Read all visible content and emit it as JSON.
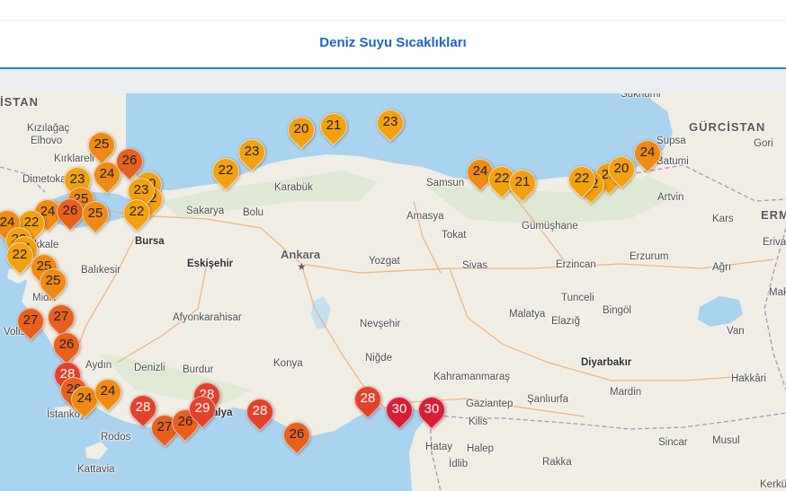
{
  "page": {
    "title": "Deniz Suyu Sıcaklıkları"
  },
  "colors": {
    "t20_23": "#f2a10f",
    "t24_25": "#ef8a12",
    "t26_27": "#e8601d",
    "t28_29": "#e2412b",
    "t30": "#d81f35"
  },
  "map": {
    "countries": [
      {
        "name": "GÜRCİSTAN"
      },
      {
        "name": "İSTAN"
      },
      {
        "name": "ERME"
      }
    ],
    "cities": [
      {
        "name": "Kızılağaç"
      },
      {
        "name": "Elhovo"
      },
      {
        "name": "Kırklareli"
      },
      {
        "name": "Dimetoka"
      },
      {
        "name": "Sakarya"
      },
      {
        "name": "Bolu"
      },
      {
        "name": "Karabük"
      },
      {
        "name": "Samsun"
      },
      {
        "name": "Artvin"
      },
      {
        "name": "Supsa"
      },
      {
        "name": "Batumi"
      },
      {
        "name": "Gori"
      },
      {
        "name": "Amasya"
      },
      {
        "name": "Tokat"
      },
      {
        "name": "Gümüşhane"
      },
      {
        "name": "Kars"
      },
      {
        "name": "Bursa"
      },
      {
        "name": "Eskişehir"
      },
      {
        "name": "Ankara"
      },
      {
        "name": "Yozgat"
      },
      {
        "name": "Sivas"
      },
      {
        "name": "Erzincan"
      },
      {
        "name": "Erzurum"
      },
      {
        "name": "Ağrı"
      },
      {
        "name": "Balıkesir"
      },
      {
        "name": "Afyonkarahisar"
      },
      {
        "name": "Tunceli"
      },
      {
        "name": "Bingöl"
      },
      {
        "name": "Elazığ"
      },
      {
        "name": "Nevşehir"
      },
      {
        "name": "Malatya"
      },
      {
        "name": "Van"
      },
      {
        "name": "Aydın"
      },
      {
        "name": "Denizli"
      },
      {
        "name": "Burdur"
      },
      {
        "name": "Konya"
      },
      {
        "name": "Niğde"
      },
      {
        "name": "Kahramanmaraş"
      },
      {
        "name": "Diyarbakır"
      },
      {
        "name": "Hakkâri"
      },
      {
        "name": "Mardin"
      },
      {
        "name": "Gaziantep"
      },
      {
        "name": "Şanlıurfa"
      },
      {
        "name": "Kilis"
      },
      {
        "name": "Hatay"
      },
      {
        "name": "Halep"
      },
      {
        "name": "İdlib"
      },
      {
        "name": "Rakka"
      },
      {
        "name": "Sincar"
      },
      {
        "name": "Musul"
      },
      {
        "name": "Kerkü"
      },
      {
        "name": "Rodos"
      },
      {
        "name": "Kattavia"
      },
      {
        "name": "İstanköy"
      },
      {
        "name": "alya"
      },
      {
        "name": "Midili"
      },
      {
        "name": "Volis"
      },
      {
        "name": "akkale"
      },
      {
        "name": "Erivan"
      },
      {
        "name": "Mak"
      },
      {
        "name": "Sukhumi"
      }
    ],
    "markers": [
      {
        "value": 20
      },
      {
        "value": 21
      },
      {
        "value": 23
      },
      {
        "value": 25
      },
      {
        "value": 26
      },
      {
        "value": 23
      },
      {
        "value": 24
      },
      {
        "value": 22
      },
      {
        "value": 23
      },
      {
        "value": 24
      },
      {
        "value": 22
      },
      {
        "value": 21
      },
      {
        "value": 24
      },
      {
        "value": 23
      },
      {
        "value": 22
      },
      {
        "value": 20
      },
      {
        "value": 22
      },
      {
        "value": 20
      },
      {
        "value": 22
      },
      {
        "value": 23
      },
      {
        "value": 24
      },
      {
        "value": 22
      },
      {
        "value": 25
      },
      {
        "value": 26
      },
      {
        "value": 25
      },
      {
        "value": 22
      },
      {
        "value": 24
      },
      {
        "value": 22
      },
      {
        "value": 21
      },
      {
        "value": 22
      },
      {
        "value": 25
      },
      {
        "value": 25
      },
      {
        "value": 27
      },
      {
        "value": 27
      },
      {
        "value": 26
      },
      {
        "value": 28
      },
      {
        "value": 26
      },
      {
        "value": 24
      },
      {
        "value": 24
      },
      {
        "value": 28
      },
      {
        "value": 27
      },
      {
        "value": 26
      },
      {
        "value": 28
      },
      {
        "value": 29
      },
      {
        "value": 28
      },
      {
        "value": 26
      },
      {
        "value": 28
      },
      {
        "value": 30
      },
      {
        "value": 30
      }
    ]
  }
}
